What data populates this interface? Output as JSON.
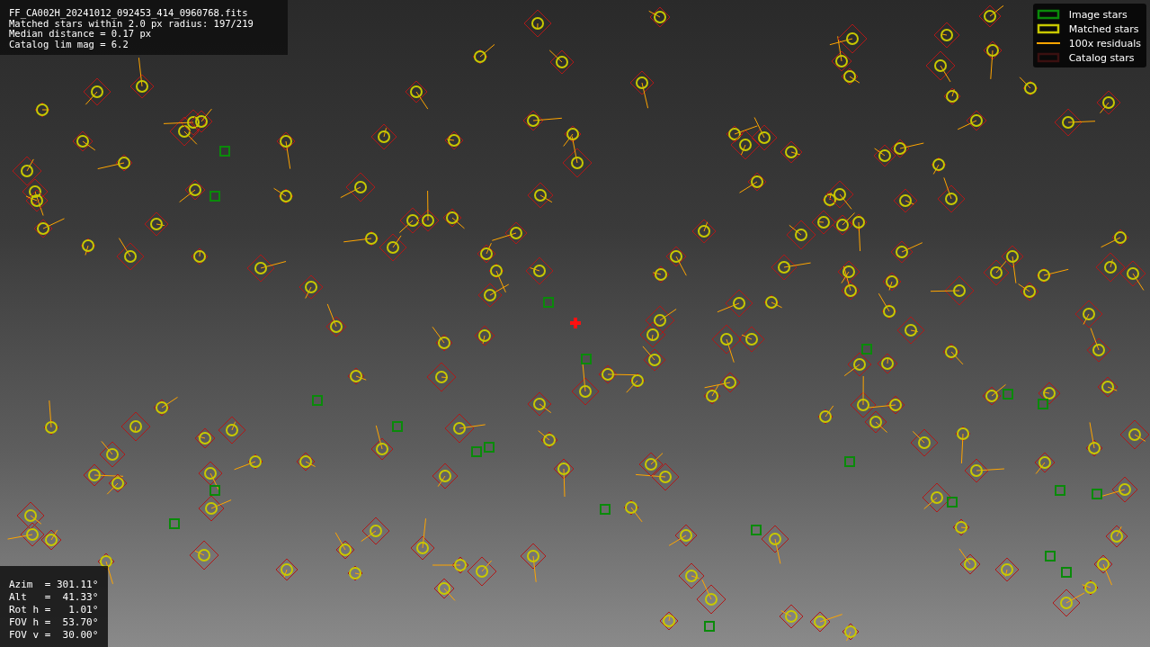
{
  "info_panel": {
    "lines": [
      "FF_CA002H_20241012_092453_414_0960768.fits",
      "Matched stars within 2.0 px radius: 197/219",
      "Median distance = 0.17 px",
      "Catalog lim mag = 6.2"
    ]
  },
  "legend": {
    "items": [
      {
        "kind": "box",
        "label": "Image stars",
        "color": "#0a8a0a"
      },
      {
        "kind": "box",
        "label": "Matched stars",
        "color": "#c8c800"
      },
      {
        "kind": "line",
        "label": "100x residuals",
        "color": "#ffa500"
      },
      {
        "kind": "box",
        "label": "Catalog stars",
        "color": "#3a1010"
      }
    ]
  },
  "pointing_panel": {
    "lines": [
      "Azim  = 301.11°",
      "Alt   =  41.33°",
      "Rot h =   1.01°",
      "FOV h =  53.70°",
      "FOV v =  30.00°"
    ]
  }
}
